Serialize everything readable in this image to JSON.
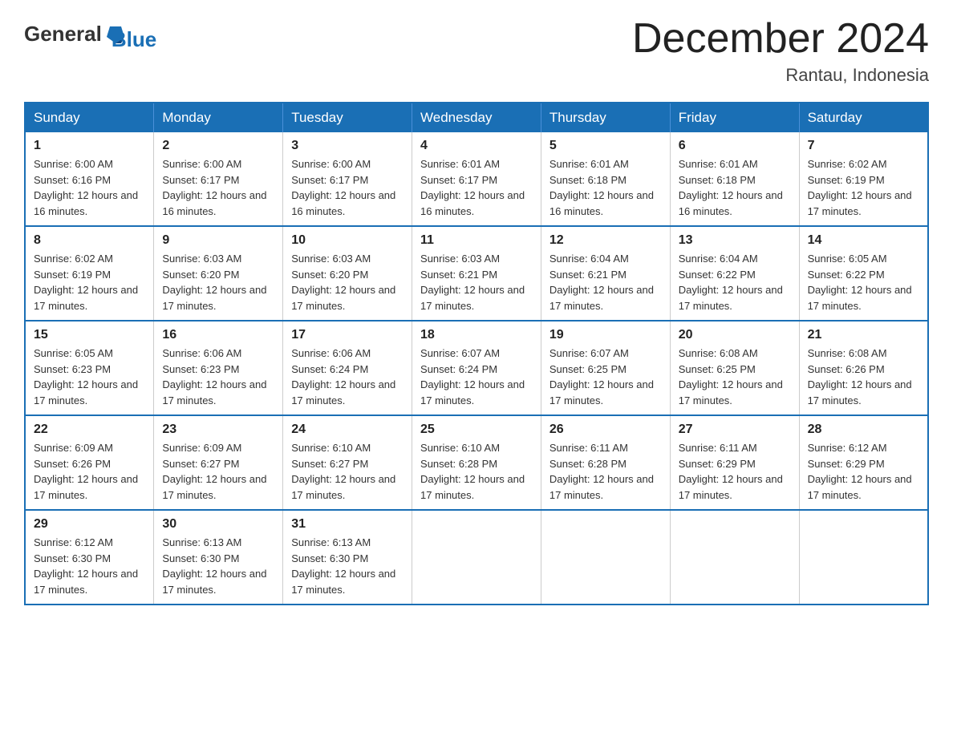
{
  "logo": {
    "text_general": "General",
    "text_blue": "Blue"
  },
  "title": {
    "month_year": "December 2024",
    "location": "Rantau, Indonesia"
  },
  "days_of_week": [
    "Sunday",
    "Monday",
    "Tuesday",
    "Wednesday",
    "Thursday",
    "Friday",
    "Saturday"
  ],
  "weeks": [
    [
      {
        "day": "1",
        "sunrise": "6:00 AM",
        "sunset": "6:16 PM",
        "daylight": "12 hours and 16 minutes."
      },
      {
        "day": "2",
        "sunrise": "6:00 AM",
        "sunset": "6:17 PM",
        "daylight": "12 hours and 16 minutes."
      },
      {
        "day": "3",
        "sunrise": "6:00 AM",
        "sunset": "6:17 PM",
        "daylight": "12 hours and 16 minutes."
      },
      {
        "day": "4",
        "sunrise": "6:01 AM",
        "sunset": "6:17 PM",
        "daylight": "12 hours and 16 minutes."
      },
      {
        "day": "5",
        "sunrise": "6:01 AM",
        "sunset": "6:18 PM",
        "daylight": "12 hours and 16 minutes."
      },
      {
        "day": "6",
        "sunrise": "6:01 AM",
        "sunset": "6:18 PM",
        "daylight": "12 hours and 16 minutes."
      },
      {
        "day": "7",
        "sunrise": "6:02 AM",
        "sunset": "6:19 PM",
        "daylight": "12 hours and 17 minutes."
      }
    ],
    [
      {
        "day": "8",
        "sunrise": "6:02 AM",
        "sunset": "6:19 PM",
        "daylight": "12 hours and 17 minutes."
      },
      {
        "day": "9",
        "sunrise": "6:03 AM",
        "sunset": "6:20 PM",
        "daylight": "12 hours and 17 minutes."
      },
      {
        "day": "10",
        "sunrise": "6:03 AM",
        "sunset": "6:20 PM",
        "daylight": "12 hours and 17 minutes."
      },
      {
        "day": "11",
        "sunrise": "6:03 AM",
        "sunset": "6:21 PM",
        "daylight": "12 hours and 17 minutes."
      },
      {
        "day": "12",
        "sunrise": "6:04 AM",
        "sunset": "6:21 PM",
        "daylight": "12 hours and 17 minutes."
      },
      {
        "day": "13",
        "sunrise": "6:04 AM",
        "sunset": "6:22 PM",
        "daylight": "12 hours and 17 minutes."
      },
      {
        "day": "14",
        "sunrise": "6:05 AM",
        "sunset": "6:22 PM",
        "daylight": "12 hours and 17 minutes."
      }
    ],
    [
      {
        "day": "15",
        "sunrise": "6:05 AM",
        "sunset": "6:23 PM",
        "daylight": "12 hours and 17 minutes."
      },
      {
        "day": "16",
        "sunrise": "6:06 AM",
        "sunset": "6:23 PM",
        "daylight": "12 hours and 17 minutes."
      },
      {
        "day": "17",
        "sunrise": "6:06 AM",
        "sunset": "6:24 PM",
        "daylight": "12 hours and 17 minutes."
      },
      {
        "day": "18",
        "sunrise": "6:07 AM",
        "sunset": "6:24 PM",
        "daylight": "12 hours and 17 minutes."
      },
      {
        "day": "19",
        "sunrise": "6:07 AM",
        "sunset": "6:25 PM",
        "daylight": "12 hours and 17 minutes."
      },
      {
        "day": "20",
        "sunrise": "6:08 AM",
        "sunset": "6:25 PM",
        "daylight": "12 hours and 17 minutes."
      },
      {
        "day": "21",
        "sunrise": "6:08 AM",
        "sunset": "6:26 PM",
        "daylight": "12 hours and 17 minutes."
      }
    ],
    [
      {
        "day": "22",
        "sunrise": "6:09 AM",
        "sunset": "6:26 PM",
        "daylight": "12 hours and 17 minutes."
      },
      {
        "day": "23",
        "sunrise": "6:09 AM",
        "sunset": "6:27 PM",
        "daylight": "12 hours and 17 minutes."
      },
      {
        "day": "24",
        "sunrise": "6:10 AM",
        "sunset": "6:27 PM",
        "daylight": "12 hours and 17 minutes."
      },
      {
        "day": "25",
        "sunrise": "6:10 AM",
        "sunset": "6:28 PM",
        "daylight": "12 hours and 17 minutes."
      },
      {
        "day": "26",
        "sunrise": "6:11 AM",
        "sunset": "6:28 PM",
        "daylight": "12 hours and 17 minutes."
      },
      {
        "day": "27",
        "sunrise": "6:11 AM",
        "sunset": "6:29 PM",
        "daylight": "12 hours and 17 minutes."
      },
      {
        "day": "28",
        "sunrise": "6:12 AM",
        "sunset": "6:29 PM",
        "daylight": "12 hours and 17 minutes."
      }
    ],
    [
      {
        "day": "29",
        "sunrise": "6:12 AM",
        "sunset": "6:30 PM",
        "daylight": "12 hours and 17 minutes."
      },
      {
        "day": "30",
        "sunrise": "6:13 AM",
        "sunset": "6:30 PM",
        "daylight": "12 hours and 17 minutes."
      },
      {
        "day": "31",
        "sunrise": "6:13 AM",
        "sunset": "6:30 PM",
        "daylight": "12 hours and 17 minutes."
      },
      null,
      null,
      null,
      null
    ]
  ]
}
